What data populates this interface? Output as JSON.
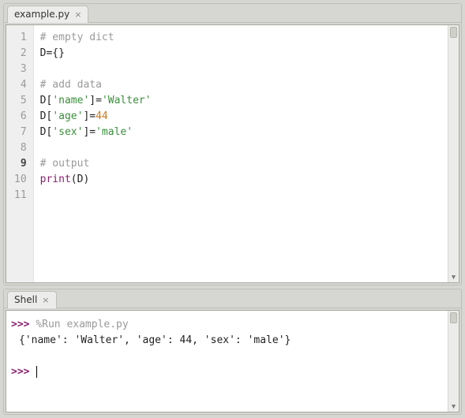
{
  "editor": {
    "tab": {
      "label": "example.py",
      "close": "×"
    },
    "active_line": 9,
    "lines": [
      {
        "n": 1,
        "tokens": [
          {
            "cls": "c-comment",
            "t": "# empty dict"
          }
        ]
      },
      {
        "n": 2,
        "tokens": [
          {
            "cls": "c-ident",
            "t": "D"
          },
          {
            "cls": "c-punct",
            "t": "={}"
          }
        ]
      },
      {
        "n": 3,
        "tokens": []
      },
      {
        "n": 4,
        "tokens": [
          {
            "cls": "c-comment",
            "t": "# add data"
          }
        ]
      },
      {
        "n": 5,
        "tokens": [
          {
            "cls": "c-ident",
            "t": "D"
          },
          {
            "cls": "c-punct",
            "t": "["
          },
          {
            "cls": "c-key",
            "t": "'name'"
          },
          {
            "cls": "c-punct",
            "t": "]="
          },
          {
            "cls": "c-string",
            "t": "'Walter'"
          }
        ]
      },
      {
        "n": 6,
        "tokens": [
          {
            "cls": "c-ident",
            "t": "D"
          },
          {
            "cls": "c-punct",
            "t": "["
          },
          {
            "cls": "c-key",
            "t": "'age'"
          },
          {
            "cls": "c-punct",
            "t": "]="
          },
          {
            "cls": "c-num",
            "t": "44"
          }
        ]
      },
      {
        "n": 7,
        "tokens": [
          {
            "cls": "c-ident",
            "t": "D"
          },
          {
            "cls": "c-punct",
            "t": "["
          },
          {
            "cls": "c-key",
            "t": "'sex'"
          },
          {
            "cls": "c-punct",
            "t": "]="
          },
          {
            "cls": "c-string",
            "t": "'male'"
          }
        ]
      },
      {
        "n": 8,
        "tokens": []
      },
      {
        "n": 9,
        "tokens": [
          {
            "cls": "c-comment",
            "t": "# output"
          }
        ]
      },
      {
        "n": 10,
        "tokens": [
          {
            "cls": "c-func",
            "t": "print"
          },
          {
            "cls": "c-punct",
            "t": "(D)"
          }
        ]
      },
      {
        "n": 11,
        "tokens": []
      }
    ]
  },
  "shell": {
    "tab": {
      "label": "Shell",
      "close": "×"
    },
    "prompt": ">>>",
    "run_cmd": "%Run example.py",
    "output": "{'name': 'Walter', 'age': 44, 'sex': 'male'}"
  }
}
